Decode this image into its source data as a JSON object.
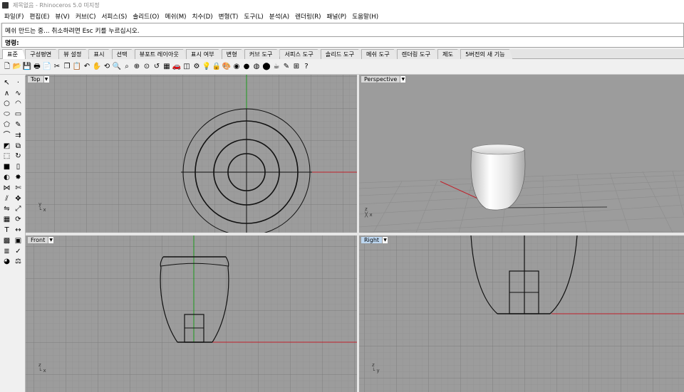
{
  "window": {
    "title": "제목없음 - Rhinoceros 5.0 미지정"
  },
  "menu": [
    "파일(F)",
    "편집(E)",
    "뷰(V)",
    "커브(C)",
    "서피스(S)",
    "솔리드(O)",
    "메쉬(M)",
    "치수(D)",
    "변형(T)",
    "도구(L)",
    "분석(A)",
    "렌더링(R)",
    "패널(P)",
    "도움말(H)"
  ],
  "command": {
    "history": "메쉬 만드는 중... 취소하려면 Esc 키를 누르십시오.",
    "prompt": "명령:",
    "value": ""
  },
  "tabs": [
    "표준",
    "구성평면",
    "뷰 설정",
    "표시",
    "선택",
    "뷰포트 레이아웃",
    "표시 여부",
    "변형",
    "커브 도구",
    "서피스 도구",
    "솔리드 도구",
    "메쉬 도구",
    "렌더링 도구",
    "제도",
    "5버전의 새 기능"
  ],
  "active_tab": "표준",
  "toolbar_icons": [
    "new-file-icon",
    "open-folder-icon",
    "save-icon",
    "print-icon",
    "import-icon",
    "cut-icon",
    "copy-icon",
    "paste-icon",
    "undo-icon",
    "pan-hand-icon",
    "rotate-view-icon",
    "zoom-icon",
    "zoom-window-icon",
    "zoom-extents-icon",
    "zoom-selected-icon",
    "viewport-undo-icon",
    "four-viewports-icon",
    "car-icon",
    "cplane-icon",
    "options-icon",
    "bulb-icon",
    "lock-icon",
    "paint-icon",
    "color-wheel-icon",
    "sphere-render-icon",
    "sphere-shaded-icon",
    "sphere-dark-icon",
    "render-teapot-icon",
    "properties-icon",
    "snap-icon",
    "help-icon"
  ],
  "sidebar_icons": [
    "select-arrow-icon",
    "point-icon",
    "polyline-icon",
    "curve-icon",
    "circle-icon",
    "arc-icon",
    "ellipse-icon",
    "rectangle-icon",
    "polygon-icon",
    "freeform-icon",
    "fillet-curve-icon",
    "offset-icon",
    "surface-icon",
    "loft-icon",
    "extrude-icon",
    "revolve-icon",
    "box-icon",
    "cylinder-icon",
    "boolean-icon",
    "explode-icon",
    "join-icon",
    "trim-icon",
    "split-icon",
    "move-icon",
    "mirror-icon",
    "scale-icon",
    "array-icon",
    "rotate-icon",
    "text-icon",
    "dimension-icon",
    "mesh-icon",
    "group-icon",
    "layer-icon",
    "check-icon",
    "render-icon",
    "analyze-icon"
  ],
  "viewports": {
    "top": {
      "label": "Top"
    },
    "perspective": {
      "label": "Perspective"
    },
    "front": {
      "label": "Front"
    },
    "right": {
      "label": "Right"
    }
  },
  "axis": {
    "x": "x",
    "y": "y",
    "z": "z"
  },
  "colors": {
    "viewport_bg": "#9c9c9c",
    "grid_minor": "#8e8e8e",
    "grid_major": "#7f7f7f",
    "axis_x": "#c0202a",
    "axis_y": "#1c9a1c",
    "active_label": "#bcd6f0"
  }
}
